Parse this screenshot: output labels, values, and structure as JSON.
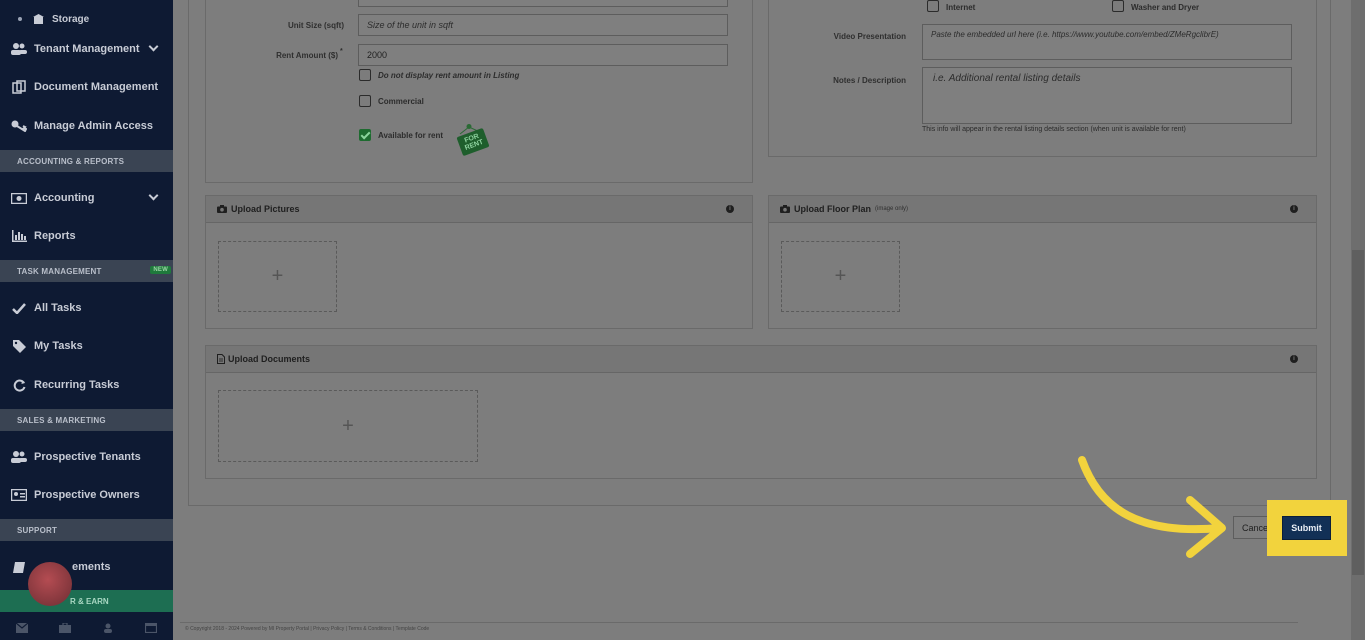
{
  "sidebar": {
    "storage": "Storage",
    "tenant_management": "Tenant Management",
    "document_management": "Document Management",
    "manage_admin_access": "Manage Admin Access",
    "section_accounting": "ACCOUNTING & REPORTS",
    "accounting": "Accounting",
    "reports": "Reports",
    "section_tasks": "TASK MANAGEMENT",
    "new_badge": "NEW",
    "all_tasks": "All Tasks",
    "my_tasks": "My Tasks",
    "recurring_tasks": "Recurring Tasks",
    "section_sales": "SALES & MARKETING",
    "prospective_tenants": "Prospective Tenants",
    "prospective_owners": "Prospective Owners",
    "section_support": "SUPPORT",
    "announcements": "ements",
    "refer_earn": "R & EARN"
  },
  "form": {
    "unit_size_label": "Unit Size (sqft)",
    "unit_size_placeholder": "Size of the unit in sqft",
    "rent_amount_label": "Rent Amount ($)",
    "rent_amount_required": "*",
    "rent_amount_value": "2000",
    "hide_rent_label": "Do not display rent amount in Listing",
    "commercial_label": "Commercial",
    "available_label": "Available for rent",
    "for_rent_sign": "FOR RENT",
    "internet_label": "Internet",
    "washer_dryer_label": "Washer and Dryer",
    "video_label": "Video Presentation",
    "video_placeholder": "Paste the embedded url here (i.e. https://www.youtube.com/embed/ZMeRgclibrE)",
    "notes_label": "Notes / Description",
    "notes_placeholder": "i.e. Additional rental listing details",
    "notes_hint": "This info will appear in the rental listing details section (when unit is available for rent)"
  },
  "uploads": {
    "pictures_title": "Upload Pictures",
    "floor_plan_title": "Upload Floor Plan",
    "floor_plan_note": "(image only)",
    "documents_title": "Upload Documents",
    "plus": "+",
    "info": "i"
  },
  "actions": {
    "cancel": "Cance",
    "submit": "Submit"
  },
  "footer": {
    "text": "© Copyright 2018 - 2024 Powered by MI Property Portal | Privacy Policy | Terms & Conditions | Template Code"
  },
  "colors": {
    "sidebar_bg": "#0e1a33",
    "highlight": "#f2d33d",
    "submit_bg": "#123056",
    "checked_green": "#1e6b30"
  }
}
